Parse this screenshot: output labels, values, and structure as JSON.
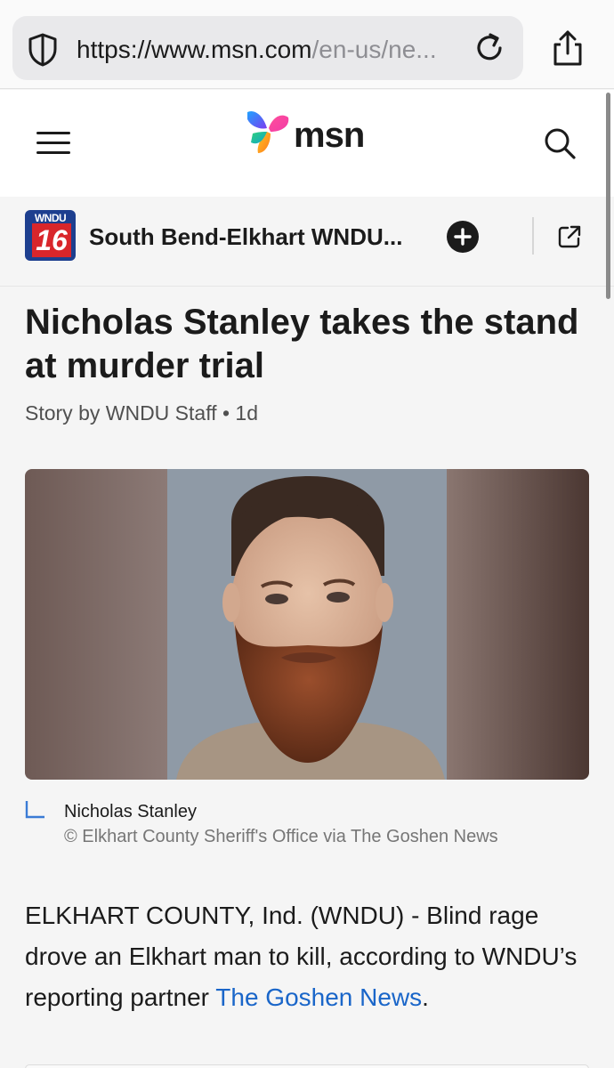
{
  "browser": {
    "url_main": "https://www.msn.com",
    "url_dim": "/en-us/ne...",
    "icons": [
      "shield-icon",
      "reload-icon",
      "share-icon"
    ]
  },
  "header": {
    "logo_text": "msn",
    "icons": [
      "hamburger-icon",
      "search-icon"
    ]
  },
  "publisher": {
    "logo_top": "WNDU",
    "logo_number": "16",
    "name": "South Bend-Elkhart WNDU...",
    "accent": "#1d3f8f",
    "logo_red": "#d9262b",
    "icons": [
      "plus-icon",
      "external-link-icon"
    ]
  },
  "article": {
    "headline": "Nicholas Stanley takes the stand at murder trial",
    "byline": "Story by WNDU Staff • 1d",
    "image_caption": "Nicholas Stanley",
    "image_credit": "© Elkhart County Sheriff's Office via The Goshen News",
    "body_lead": "ELKHART COUNTY, Ind. (WNDU) - Blind rage drove an Elkhart man to kill, according to WNDU’s reporting partner ",
    "body_link": "The Goshen News",
    "body_end": ".",
    "link_color": "#1a66c9"
  }
}
